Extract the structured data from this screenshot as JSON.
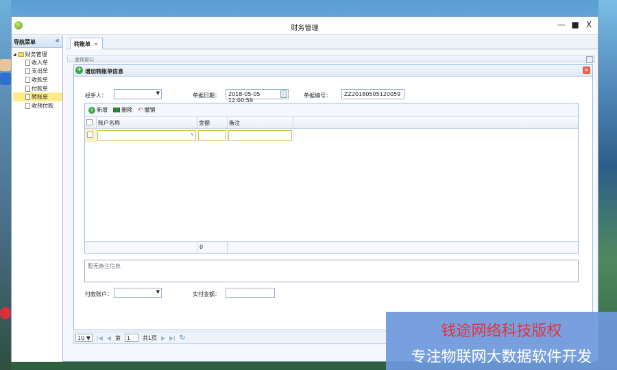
{
  "window": {
    "title": "财务管理"
  },
  "window_controls": {
    "minimize": "—",
    "maximize": "■",
    "close": "X"
  },
  "sidebar": {
    "title": "导航菜单",
    "collapse": "«",
    "root": "财务管理",
    "items": [
      {
        "label": "收入单"
      },
      {
        "label": "支出单"
      },
      {
        "label": "收款单"
      },
      {
        "label": "付款单"
      },
      {
        "label": "转账单",
        "active": true
      },
      {
        "label": "收预付款"
      }
    ]
  },
  "tabs": [
    {
      "label": "转账单",
      "close": "×"
    }
  ],
  "query_strip": {
    "label": "查询窗口"
  },
  "dialog": {
    "title": "增加转账单信息",
    "close": "✕",
    "handler_label": "经手人：",
    "handler_value": "",
    "date_label": "单据日期：",
    "date_value": "2018-05-05 12:00:59",
    "number_label": "单据编号：",
    "number_value": "ZZ20180505120059",
    "toolbar": {
      "add": "新增",
      "delete": "删除",
      "undo": "撤销"
    },
    "grid": {
      "columns": [
        "账户名称",
        "金额",
        "备注"
      ],
      "footer_amount": "0"
    },
    "remark_placeholder": "暂无备注信息",
    "pay_account_label": "付款账户：",
    "pay_account_value": "",
    "paid_amount_label": "实付金额：",
    "paid_amount_value": ""
  },
  "pager": {
    "page_size": "10",
    "page_prefix": "第",
    "page_value": "1",
    "page_total": "共1页"
  },
  "watermark": {
    "line1": "钱途网络科技版权",
    "line2": "专注物联网大数据软件开发"
  },
  "colors": {
    "accent": "#99bbe8",
    "active_row": "#fbec88",
    "watermark_bg": "#6c98dc"
  }
}
